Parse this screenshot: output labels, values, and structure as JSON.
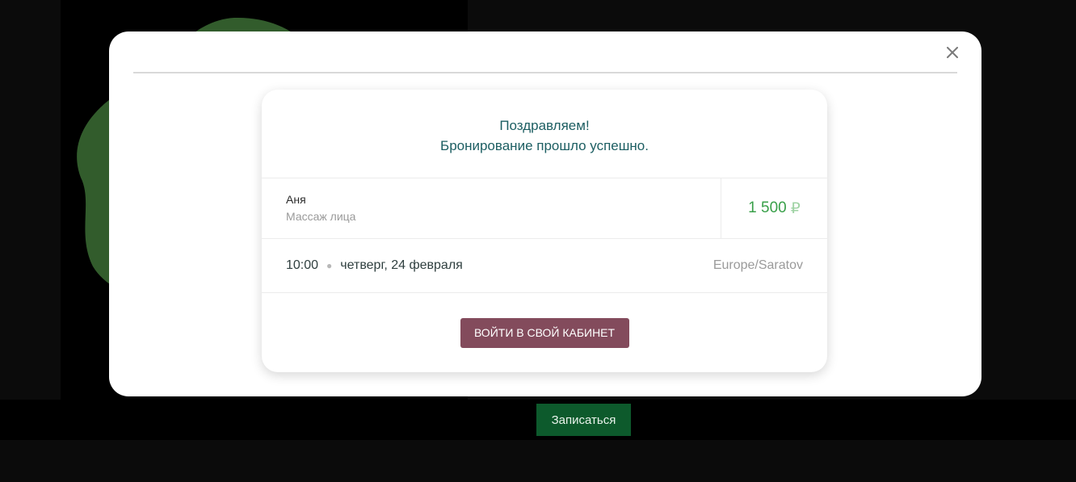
{
  "backdrop": {
    "book_button_label": "Записаться",
    "accent_color": "#0d5a2c"
  },
  "modal": {
    "close_icon": "close-icon",
    "success": {
      "line1": "Поздравляем!",
      "line2": "Бронирование прошло успешно."
    },
    "booking": {
      "master": "Аня",
      "service": "Массаж лица",
      "price": "1 500",
      "currency": "₽",
      "time": "10:00",
      "date": "четверг, 24 февраля",
      "timezone": "Europe/Saratov"
    },
    "cabinet_button_label": "ВОЙТИ В СВОЙ КАБИНЕТ",
    "colors": {
      "heading": "#1c5e62",
      "price": "#3aa04a",
      "button": "#834b5c"
    }
  }
}
